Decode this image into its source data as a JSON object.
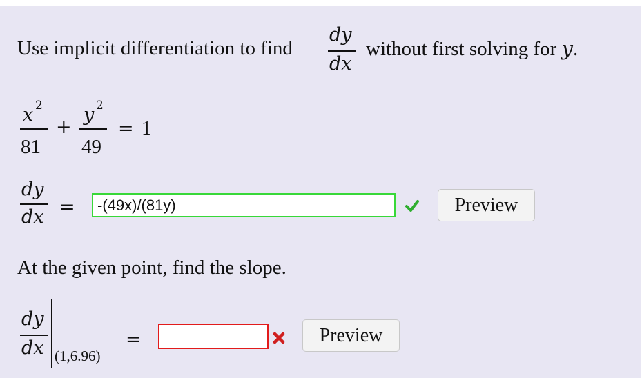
{
  "question": {
    "prompt_before": "Use implicit differentiation to find",
    "prompt_after": "without first solving for",
    "prompt_var": "y",
    "prompt_end": ".",
    "deriv_num": "dy",
    "deriv_den": "dx"
  },
  "equation": {
    "term1_num": "x",
    "term1_exp": "2",
    "term1_den": "81",
    "plus": "+",
    "term2_num": "y",
    "term2_exp": "2",
    "term2_den": "49",
    "equals": "=",
    "rhs": "1"
  },
  "part1": {
    "lhs_num": "dy",
    "lhs_den": "dx",
    "equals": "=",
    "answer_value": "-(49x)/(81y)",
    "status": "correct",
    "status_color": "#2fae2f",
    "status_icon": "check-icon",
    "preview_label": "Preview"
  },
  "part2": {
    "instruction": "At the given point, find the slope.",
    "lhs_num": "dy",
    "lhs_den": "dx",
    "eval_point": "(1,6.96)",
    "equals": "=",
    "answer_value": "",
    "status": "incorrect",
    "status_color": "#d01f1f",
    "status_icon": "x-icon",
    "preview_label": "Preview"
  },
  "colors": {
    "panel_bg": "#e8e6f3",
    "correct_border": "#38d838",
    "incorrect_border": "#e21b1b"
  }
}
